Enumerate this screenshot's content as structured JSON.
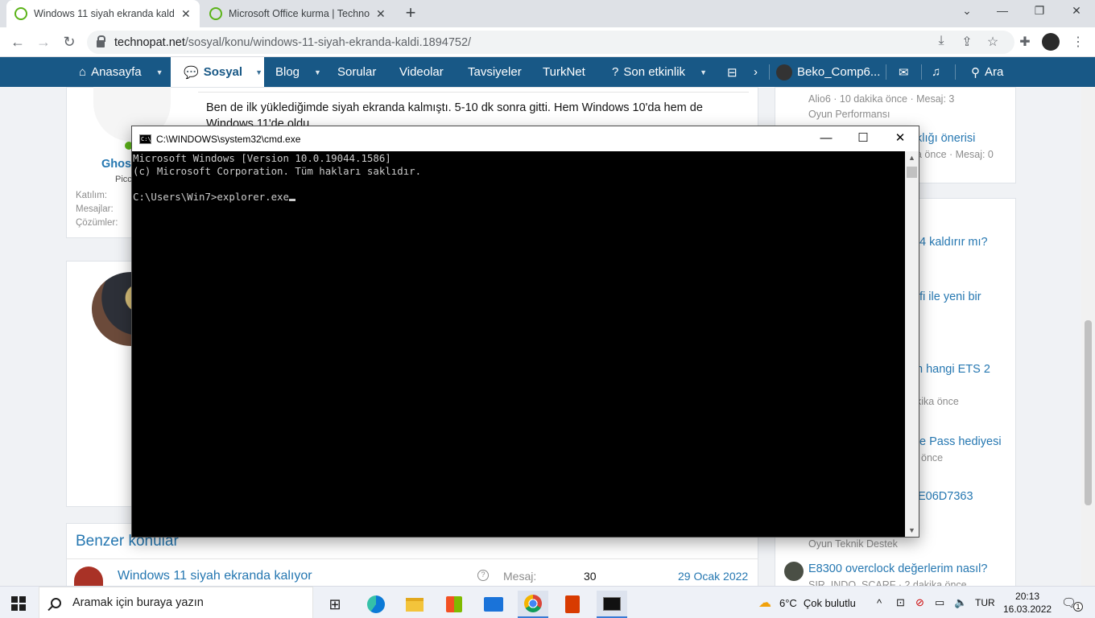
{
  "browser": {
    "tabs": [
      {
        "title": "Windows 11 siyah ekranda kaldı | Technopat Sosyal",
        "active": true
      },
      {
        "title": "Microsoft Office kurma | Technopat Sosyal",
        "active": false
      }
    ],
    "url_domain": "technopat.net",
    "url_path": "/sosyal/konu/windows-11-siyah-ekranda-kaldi.1894752/"
  },
  "sitenav": {
    "home": "Anasayfa",
    "social": "Sosyal",
    "blog": "Blog",
    "questions": "Sorular",
    "videos": "Videolar",
    "recommendations": "Tavsiyeler",
    "turknet": "TurkNet",
    "recent": "Son etkinlik",
    "user": "Beko_Comp6...",
    "search": "Ara"
  },
  "post": {
    "text_line1": "Ben de ilk yüklediğimde siyah ekranda kalmıştı. 5-10 dk sonra gitti. Hem Windows 10'da hem de",
    "text_line2": "Windows 11'de oldu.",
    "author_partial": "Ghos",
    "role_partial": "Picc",
    "stat_joined": "Katılım:",
    "stat_messages": "Mesajlar:",
    "stat_solutions": "Çözümler:"
  },
  "similar": {
    "heading": "Benzer konular",
    "row": {
      "title": "Windows 11 siyah ekranda kalıyor",
      "label": "Mesaj:",
      "count": "30",
      "date": "29 Ocak 2022"
    }
  },
  "sidebar": {
    "meta1": "Alio6 · 10 dakika önce · Mesaj: 3",
    "cat1": "Oyun Performansı",
    "title1_partial": "klığı önerisi",
    "meta2_partial": "a önce · Mesaj: 0",
    "title2_partial": "4 kaldırır mı?",
    "title3_partial": "fi ile yeni bir",
    "title4_partial": "n hangi ETS 2",
    "meta4_partial": "kika önce",
    "title5_partial": "e Pass hediyesi",
    "meta5_partial": "önce",
    "title6_partial": "E06D7363",
    "cat6": "Oyun Teknik Destek",
    "title7": "E8300 overclock değerlerim nasıl?",
    "meta7_partial": "SIR_INDO_SCARF · 2 dakika önce"
  },
  "cmd": {
    "title": "C:\\WINDOWS\\system32\\cmd.exe",
    "line1": "Microsoft Windows [Version 10.0.19044.1586]",
    "line2": "(c) Microsoft Corporation. Tüm hakları saklıdır.",
    "prompt": "C:\\Users\\Win7>explorer.exe"
  },
  "taskbar": {
    "search_placeholder": "Aramak için buraya yazın",
    "weather_temp": "6°C",
    "weather_desc": "Çok bulutlu",
    "language": "TUR",
    "time": "20:13",
    "date": "16.03.2022",
    "notification_count": "1"
  },
  "colors": {
    "site_nav": "#185886",
    "link": "#2577b1",
    "cmd_text": "#cccccc"
  }
}
